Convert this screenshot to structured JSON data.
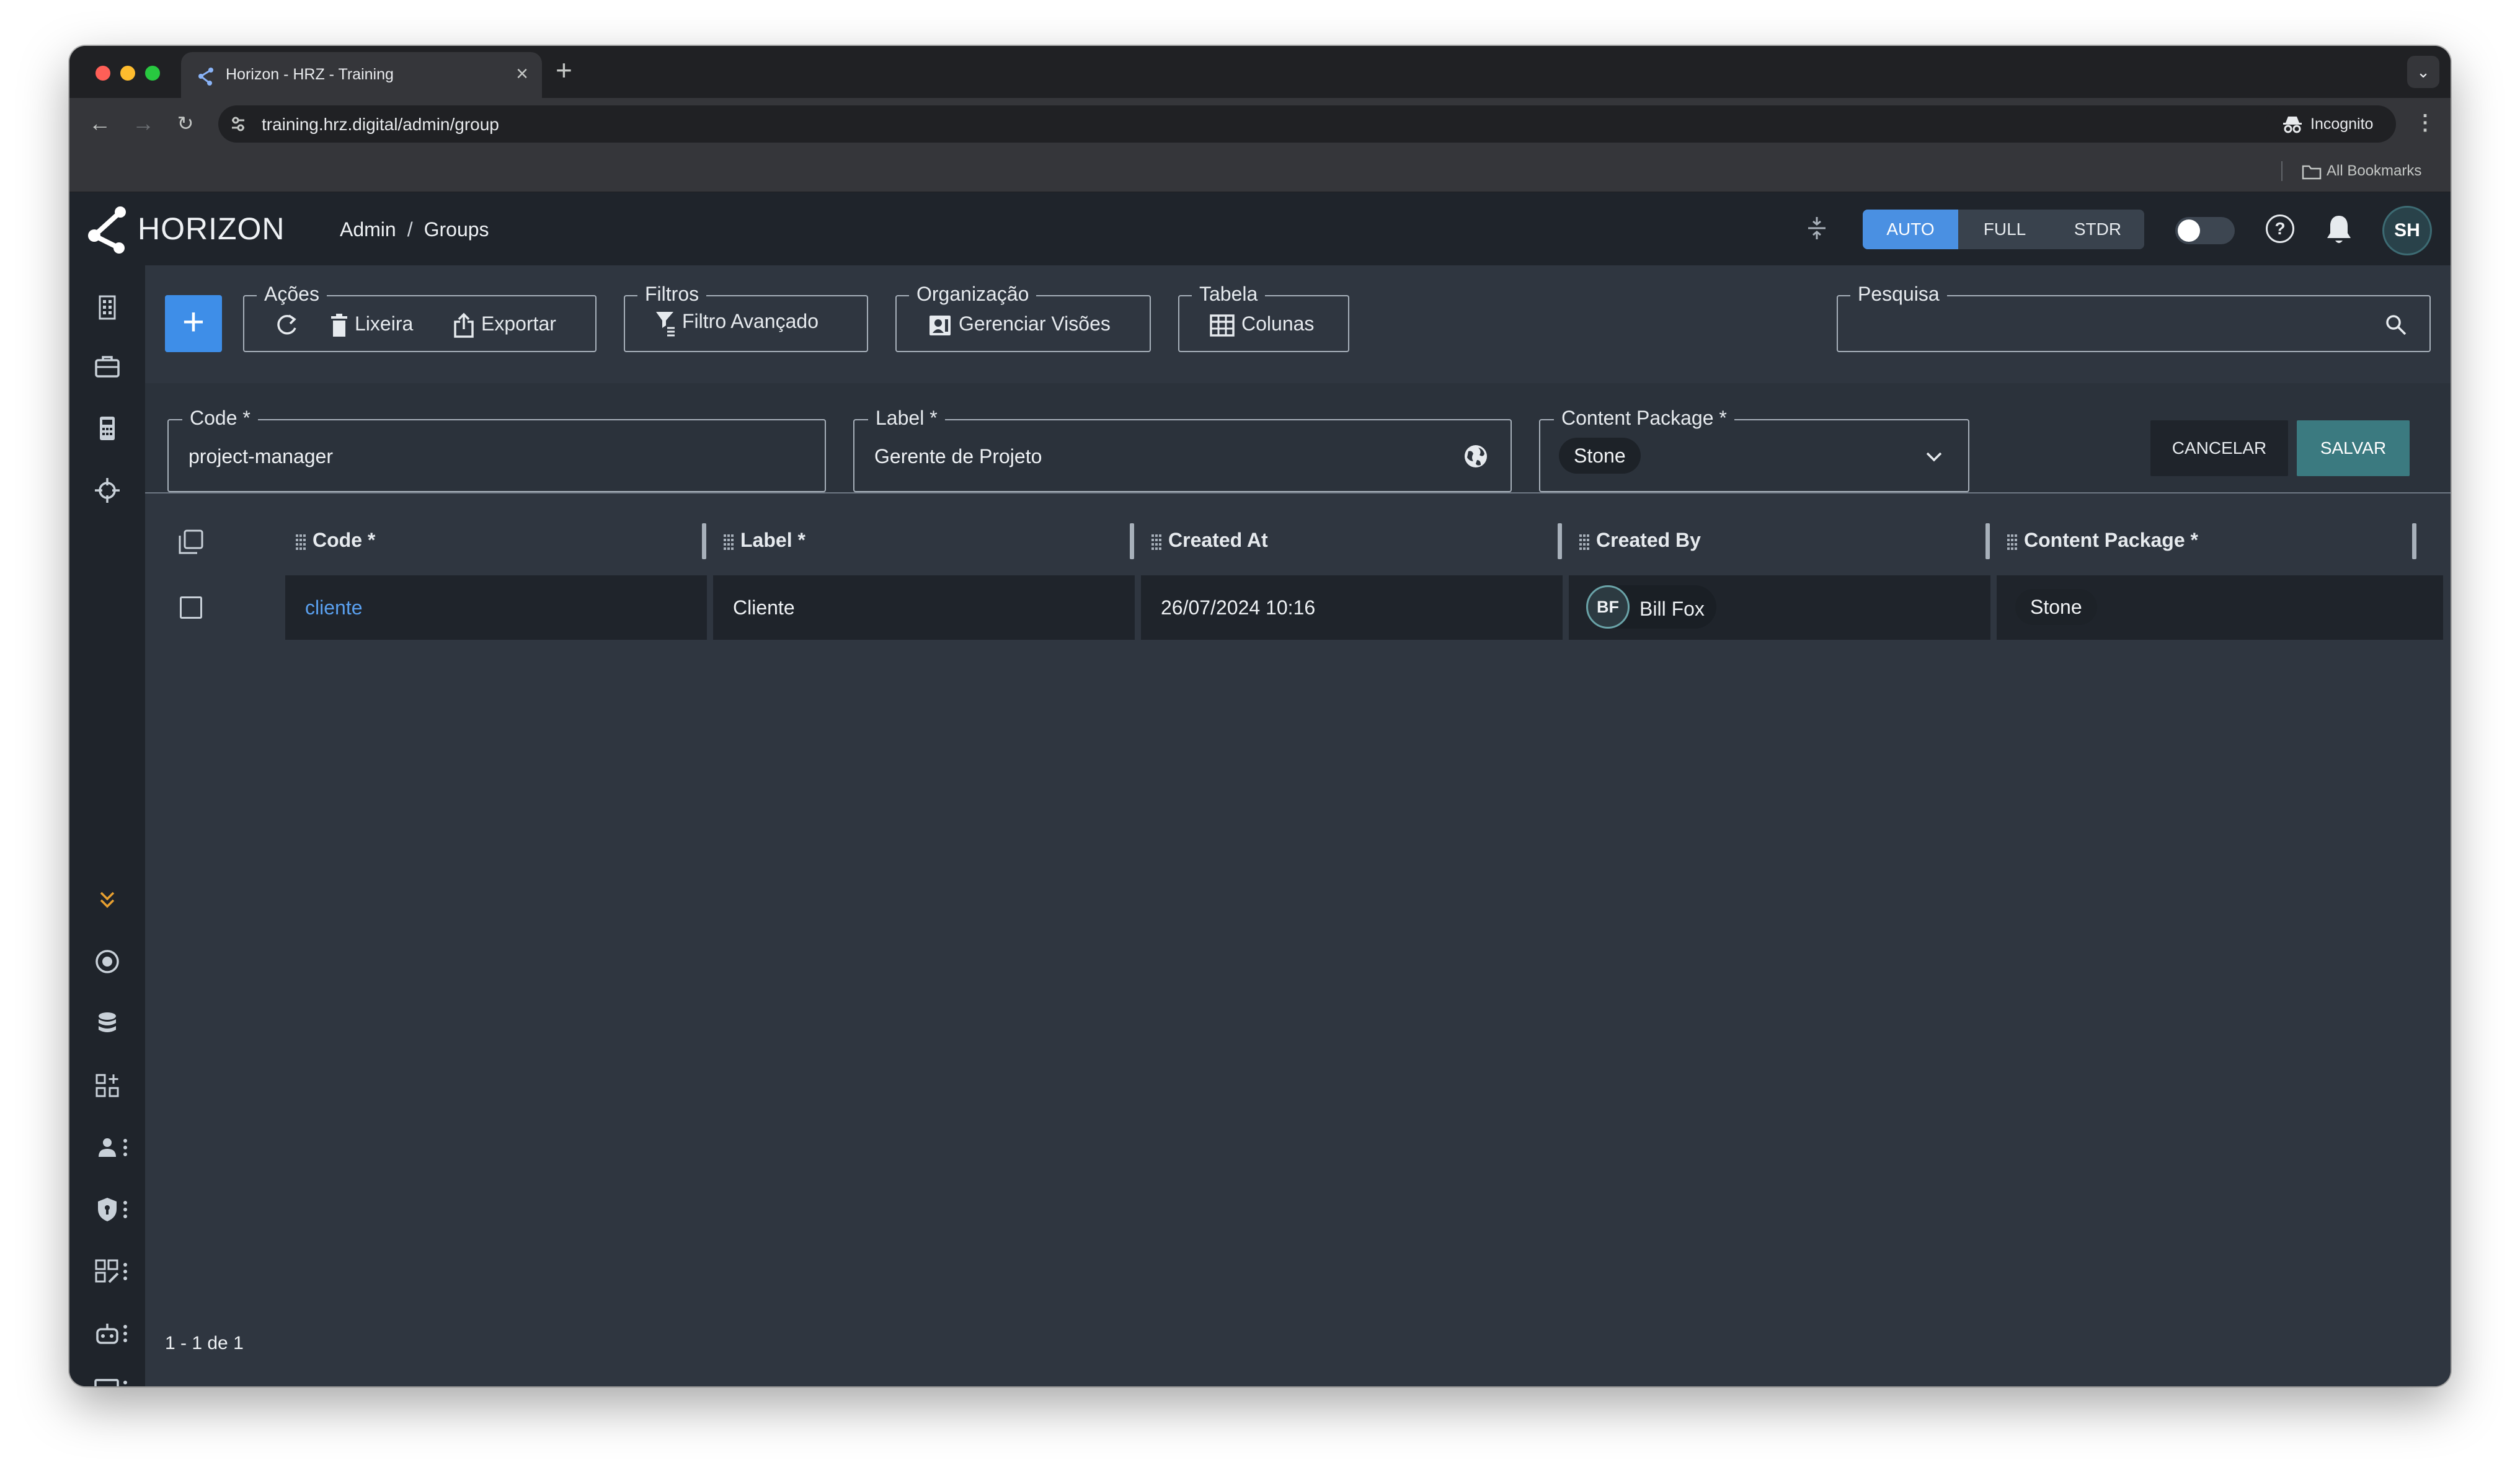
{
  "browser": {
    "tab_title": "Horizon - HRZ - Training",
    "url": "training.hrz.digital/admin/group",
    "incognito_label": "Incognito",
    "bookmarks_label": "All Bookmarks"
  },
  "app": {
    "logo_text": "HORIZON",
    "breadcrumb": {
      "root": "Admin",
      "separator": "/",
      "current": "Groups"
    },
    "view_modes": [
      "AUTO",
      "FULL",
      "STDR"
    ],
    "active_view_mode": "AUTO",
    "user_initials": "SH"
  },
  "sidebar": {
    "top_icons": [
      "building-icon",
      "briefcase-icon",
      "calculator-icon",
      "crosshair-icon"
    ],
    "bottom_icons": [
      "chevrons-down-icon",
      "circle-target-icon",
      "database-icon",
      "grid-plus-icon",
      "user-menu-icon",
      "shield-menu-icon",
      "qr-menu-icon",
      "robot-menu-icon",
      "screen-menu-icon"
    ]
  },
  "toolbar": {
    "acoes": {
      "legend": "Ações",
      "lixeira": "Lixeira",
      "exportar": "Exportar"
    },
    "filtros": {
      "legend": "Filtros",
      "filtro_avancado": "Filtro Avançado"
    },
    "organizacao": {
      "legend": "Organização",
      "gerenciar_visoes": "Gerenciar Visões"
    },
    "tabela": {
      "legend": "Tabela",
      "colunas": "Colunas"
    },
    "pesquisa": {
      "legend": "Pesquisa",
      "value": ""
    }
  },
  "edit_form": {
    "code": {
      "label": "Code *",
      "value": "project-manager"
    },
    "label": {
      "label": "Label *",
      "value": "Gerente de Projeto"
    },
    "content_package": {
      "label": "Content Package *",
      "value": "Stone"
    },
    "cancel_label": "CANCELAR",
    "save_label": "SALVAR"
  },
  "table": {
    "columns": [
      "Code *",
      "Label *",
      "Created At",
      "Created By",
      "Content Package *"
    ],
    "rows": [
      {
        "code": "cliente",
        "label": "Cliente",
        "created_at": "26/07/2024 10:16",
        "created_by": {
          "initials": "BF",
          "name": "Bill Fox"
        },
        "content_package": "Stone"
      }
    ],
    "pagination": "1 - 1 de 1"
  },
  "colors": {
    "accent_blue": "#3e8ee8",
    "save_teal": "#3b7a80",
    "link": "#5aa0ef",
    "warning_orange": "#e8a030"
  }
}
